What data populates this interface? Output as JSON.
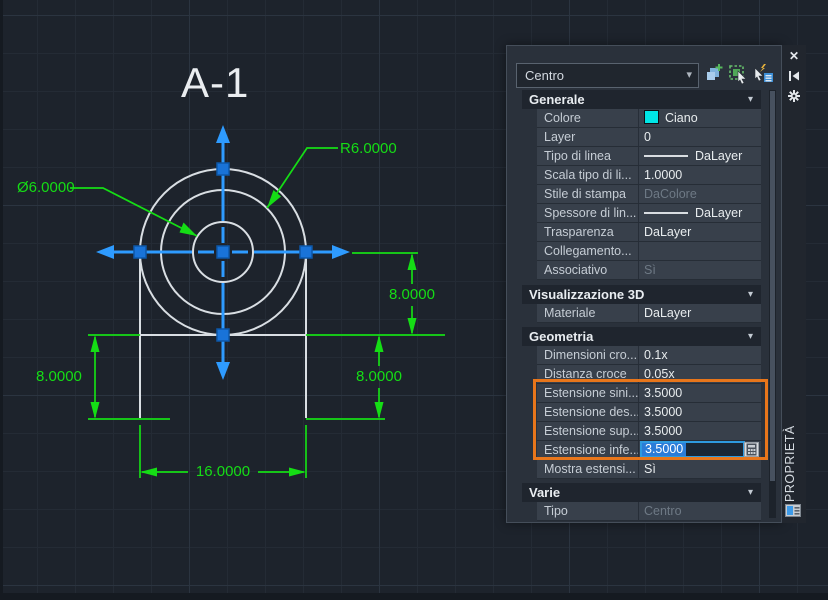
{
  "canvas": {
    "title": "A-1",
    "labels": {
      "radius": "R6.0000",
      "diameter": "Ø6.0000",
      "left_height": "8.0000",
      "right_height": "8.0000",
      "upper_right_height": "8.0000",
      "bottom_width": "16.0000"
    },
    "colors": {
      "dimension_green": "#15DD15",
      "geometry_white": "#D9DEE3",
      "center_mark_blue": "#2E9BFF",
      "grip_fill": "#1973D8",
      "background": "#1D232C"
    }
  },
  "panel": {
    "tab_title": "PROPRIETÀ",
    "selector_value": "Centro",
    "highlight_color": "#E8761B",
    "generale": {
      "title": "Generale",
      "rows": {
        "colore": {
          "label": "Colore",
          "value": "Ciano",
          "swatch": "#00E6E6"
        },
        "layer": {
          "label": "Layer",
          "value": "0"
        },
        "tipo_linea": {
          "label": "Tipo di linea",
          "value": "DaLayer"
        },
        "scala": {
          "label": "Scala tipo di li...",
          "value": "1.0000"
        },
        "stile": {
          "label": "Stile di stampa",
          "value": "DaColore"
        },
        "spessore": {
          "label": "Spessore di lin...",
          "value": "DaLayer"
        },
        "trasparenza": {
          "label": "Trasparenza",
          "value": "DaLayer"
        },
        "collegamento": {
          "label": "Collegamento...",
          "value": ""
        },
        "associativo": {
          "label": "Associativo",
          "value": "Sì"
        }
      }
    },
    "vis3d": {
      "title": "Visualizzazione 3D",
      "rows": {
        "materiale": {
          "label": "Materiale",
          "value": "DaLayer"
        }
      }
    },
    "geometria": {
      "title": "Geometria",
      "rows": {
        "dim_croce": {
          "label": "Dimensioni cro...",
          "value": "0.1x"
        },
        "dist_croce": {
          "label": "Distanza croce",
          "value": "0.05x"
        },
        "est_sin": {
          "label": "Estensione sini...",
          "value": "3.5000"
        },
        "est_des": {
          "label": "Estensione des...",
          "value": "3.5000"
        },
        "est_sup": {
          "label": "Estensione sup...",
          "value": "3.5000"
        },
        "est_inf": {
          "label": "Estensione infe...",
          "value": "3.5000"
        },
        "mostra": {
          "label": "Mostra estensi...",
          "value": "Sì"
        }
      }
    },
    "varie": {
      "title": "Varie",
      "rows": {
        "tipo": {
          "label": "Tipo",
          "value": "Centro"
        }
      }
    }
  },
  "icons": {
    "chevron_down": "▾",
    "close": "✕"
  }
}
